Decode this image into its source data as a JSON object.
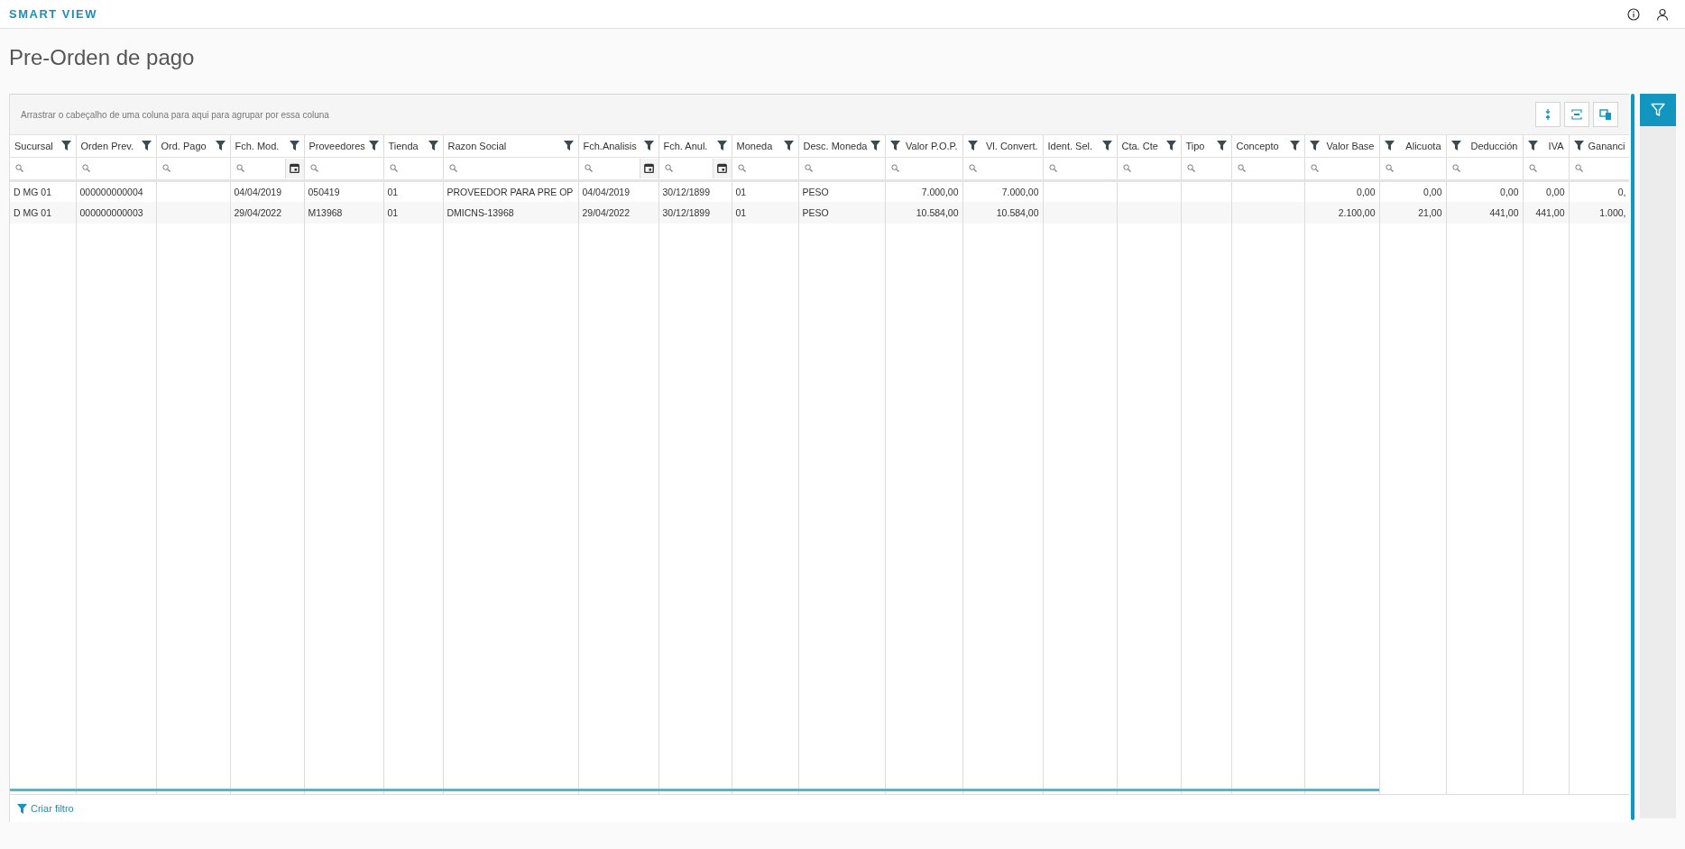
{
  "app": {
    "brand": "SMART VIEW"
  },
  "page": {
    "title": "Pre-Orden de pago"
  },
  "grid": {
    "group_hint": "Arrastrar o cabeçalho de uma coluna para aqui para agrupar por essa coluna",
    "columns": [
      {
        "label": "Sucursal",
        "kind": "text"
      },
      {
        "label": "Orden Prev.",
        "kind": "text"
      },
      {
        "label": "Ord. Pago",
        "kind": "text"
      },
      {
        "label": "Fch. Mod.",
        "kind": "date"
      },
      {
        "label": "Proveedores",
        "kind": "text"
      },
      {
        "label": "Tienda",
        "kind": "text"
      },
      {
        "label": "Razon Social",
        "kind": "text"
      },
      {
        "label": "Fch.Analisis",
        "kind": "date"
      },
      {
        "label": "Fch. Anul.",
        "kind": "date"
      },
      {
        "label": "Moneda",
        "kind": "text"
      },
      {
        "label": "Desc. Moneda",
        "kind": "text"
      },
      {
        "label": "Valor P.O.P.",
        "kind": "number"
      },
      {
        "label": "Vl. Convert.",
        "kind": "number"
      },
      {
        "label": "Ident. Sel.",
        "kind": "text"
      },
      {
        "label": "Cta. Cte",
        "kind": "text"
      },
      {
        "label": "Tipo",
        "kind": "text"
      },
      {
        "label": "Concepto",
        "kind": "text"
      },
      {
        "label": "Valor Base",
        "kind": "number"
      },
      {
        "label": "Alicuota",
        "kind": "number"
      },
      {
        "label": "Deducción",
        "kind": "number"
      },
      {
        "label": "IVA",
        "kind": "number"
      },
      {
        "label": "Gananci",
        "kind": "number"
      }
    ],
    "rows": [
      {
        "cells": [
          "D MG 01",
          "000000000004",
          null,
          "04/04/2019",
          "050419",
          "01",
          "PROVEEDOR PARA PRE OP",
          "04/04/2019",
          "30/12/1899",
          "01",
          "PESO",
          "7.000,00",
          "7.000,00",
          null,
          null,
          null,
          null,
          "0,00",
          "0,00",
          "0,00",
          "0,00",
          "0,"
        ]
      },
      {
        "cells": [
          "D MG 01",
          "000000000003",
          null,
          "29/04/2022",
          "M13968",
          "01",
          "DMICNS-13968",
          "29/04/2022",
          "30/12/1899",
          "01",
          "PESO",
          "10.584,00",
          "10.584,00",
          null,
          null,
          null,
          null,
          "2.100,00",
          "21,00",
          "441,00",
          "441,00",
          "1.000,"
        ]
      }
    ]
  },
  "footer": {
    "link": "Criar filtro"
  }
}
